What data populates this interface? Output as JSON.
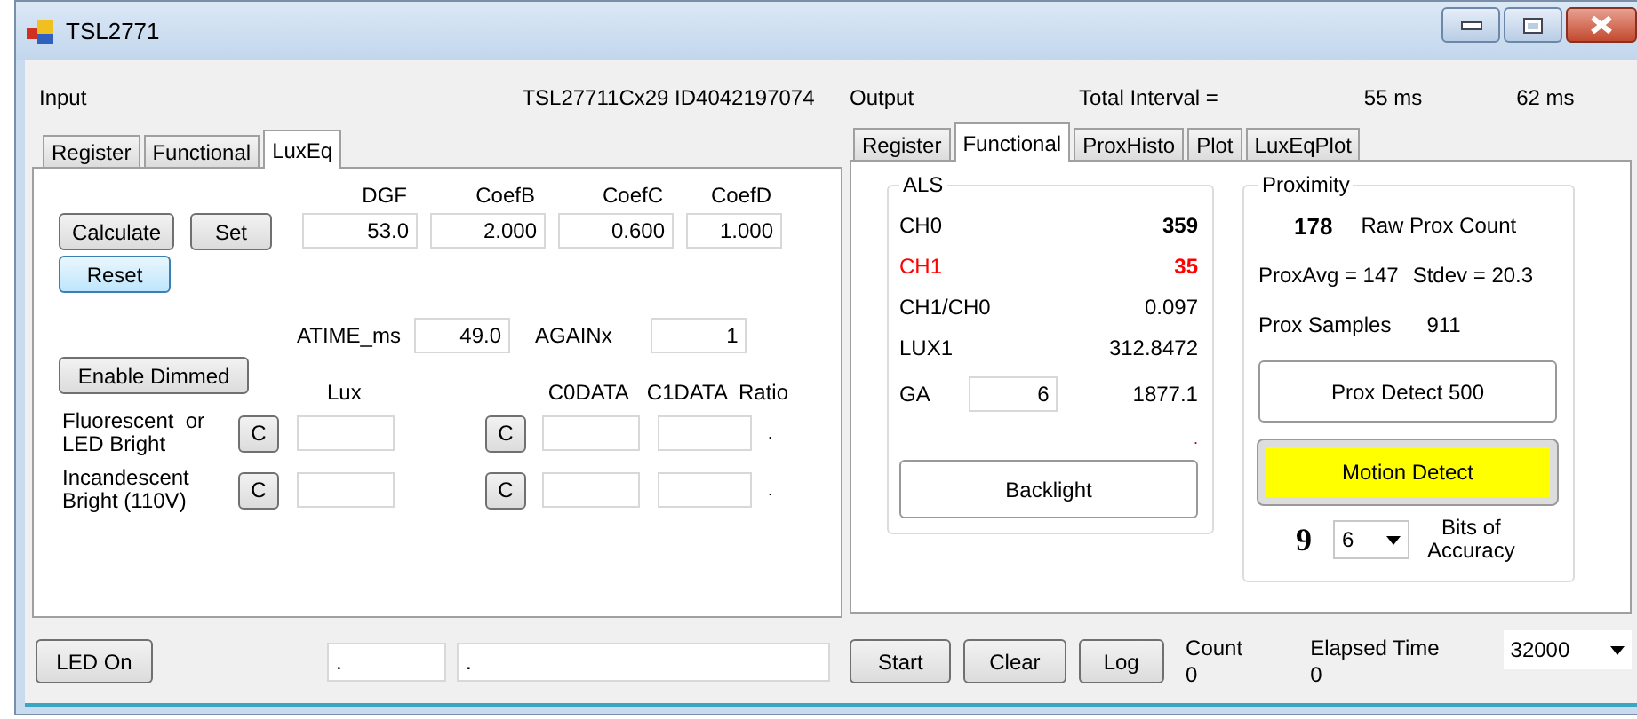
{
  "window": {
    "title": "TSL2771"
  },
  "input": {
    "label": "Input",
    "device": "TSL27711Cx29 ID4042197074",
    "tabs": [
      {
        "label": "Register",
        "selected": false
      },
      {
        "label": "Functional",
        "selected": false
      },
      {
        "label": "LuxEq",
        "selected": true
      }
    ],
    "coefficients": [
      {
        "label": "DGF",
        "value": "53.0"
      },
      {
        "label": "CoefB",
        "value": "2.000"
      },
      {
        "label": "CoefC",
        "value": "0.600"
      },
      {
        "label": "CoefD",
        "value": "1.000"
      }
    ],
    "buttons": [
      {
        "label": "Calculate",
        "kind": "normal"
      },
      {
        "label": "Set",
        "kind": "normal"
      },
      {
        "label": "Reset",
        "kind": "focused"
      }
    ],
    "settings": [
      {
        "label": "ATIME_ms",
        "value": "49.0"
      },
      {
        "label": "AGAINx",
        "value": "1"
      }
    ],
    "dimmed_button": "Enable Dimmed",
    "columns": {
      "lux": "Lux",
      "c0": "C0DATA",
      "c1": "C1DATA",
      "ratio": "Ratio"
    },
    "light_rows": [
      {
        "label": "Fluorescent  or\nLED Bright",
        "clear_buttons": [
          "C",
          "C"
        ],
        "ratio": "."
      },
      {
        "label": "Incandescent\nBright (110V)",
        "clear_buttons": [
          "C",
          "C"
        ],
        "ratio": "."
      }
    ]
  },
  "output": {
    "label": "Output",
    "interval_label": "Total Interval =",
    "interval_values": [
      "55 ms",
      "62 ms"
    ],
    "tabs": [
      {
        "label": "Register",
        "selected": false
      },
      {
        "label": "Functional",
        "selected": true
      },
      {
        "label": "ProxHisto",
        "selected": false
      },
      {
        "label": "Plot",
        "selected": false
      },
      {
        "label": "LuxEqPlot",
        "selected": false
      }
    ],
    "als": {
      "title": "ALS",
      "rows": [
        {
          "label": "CH0",
          "value": "359",
          "bold": true,
          "alert": false
        },
        {
          "label": "CH1",
          "value": "35",
          "bold": true,
          "alert": true
        },
        {
          "label": "CH1/CH0",
          "value": "0.097",
          "bold": false,
          "alert": false
        },
        {
          "label": "LUX1",
          "value": "312.8472",
          "bold": false,
          "alert": false
        }
      ],
      "ga": {
        "label": "GA",
        "input": "6",
        "value": "1877.1"
      },
      "marker": ".",
      "button": "Backlight"
    },
    "proximity": {
      "title": "Proximity",
      "raw_count": "178",
      "raw_label": "Raw Prox Count",
      "avg": "ProxAvg = 147",
      "stdev": "Stdev = 20.3",
      "samples_label": "Prox Samples",
      "samples": "911",
      "buttons": [
        {
          "label": "Prox Detect 500",
          "kind": "normal"
        },
        {
          "label": "Motion Detect",
          "kind": "alert"
        }
      ],
      "bits": "9",
      "bits_select": "6",
      "bits_label": "Bits of\nAccuracy"
    }
  },
  "footer": {
    "led_button": "LED On",
    "fields": [
      ".",
      "."
    ],
    "actions": [
      "Start",
      "Clear",
      "Log"
    ],
    "count": {
      "label": "Count",
      "value": "0"
    },
    "elapsed": {
      "label": "Elapsed Time",
      "value": "0"
    },
    "rate": "32000"
  }
}
